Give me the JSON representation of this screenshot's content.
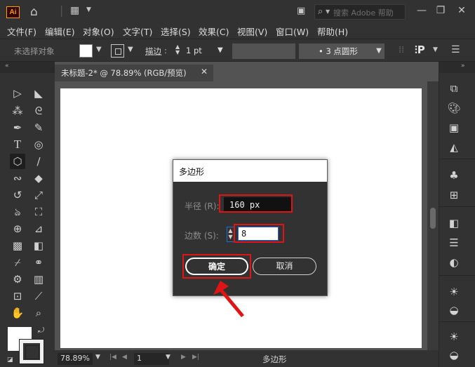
{
  "app": {
    "logo": "Ai"
  },
  "titlebar": {
    "search_placeholder": "搜索 Adobe 帮助",
    "minimize": "—",
    "restore": "❐",
    "close": "✕"
  },
  "menu": [
    "文件(F)",
    "编辑(E)",
    "对象(O)",
    "文字(T)",
    "选择(S)",
    "效果(C)",
    "视图(V)",
    "窗口(W)",
    "帮助(H)"
  ],
  "control": {
    "selection_status": "未选择对象",
    "stroke_label": "描边",
    "stroke_value": "1 pt",
    "brush": "• 3 点圆形"
  },
  "document": {
    "tab_title": "未标题-2* @ 78.89% (RGB/预览)",
    "tab_close": "✕"
  },
  "status": {
    "zoom": "78.89%",
    "page": "1",
    "current_tool": "多边形"
  },
  "dialog": {
    "title": "多边形",
    "radius_label": "半径 (R):",
    "radius_value": "160 px",
    "sides_label": "边数 (S):",
    "sides_value": "8",
    "ok": "确定",
    "cancel": "取消"
  },
  "colors": {
    "highlight": "#e01414",
    "accent": "#1a6ad6",
    "logo_orange": "#ff9a00"
  }
}
